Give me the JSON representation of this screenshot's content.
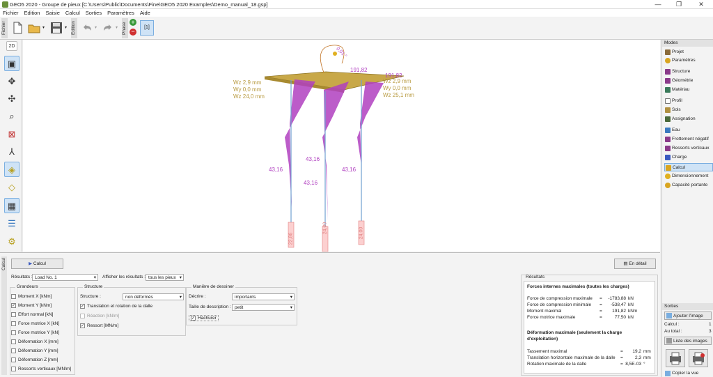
{
  "window": {
    "title": "GEO5 2020 - Groupe de pieux [C:\\Users\\Public\\Documents\\Fine\\GEO5 2020 Examples\\Demo_manual_18.gsp]",
    "minimize": "—",
    "maximize": "❐",
    "close": "✕"
  },
  "menu": [
    "Fichier",
    "Edition",
    "Saisie",
    "Calcul",
    "Sorties",
    "Paramètres",
    "Aide"
  ],
  "toolbar": {
    "fichier_tab": "Fichier",
    "edition_tab": "Edition",
    "phase_tab": "Phase",
    "phase_value": "[1]"
  },
  "view": {
    "mode_2d": "2D"
  },
  "drawing": {
    "labels_left": [
      "Wz 2,9 mm",
      "Wy 0,0 mm",
      "Wz 24,0 mm"
    ],
    "labels_right": [
      "Wz 2,9 mm",
      "Wy 0,0 mm",
      "Wz 25,1 mm"
    ],
    "moment_top": "191,82",
    "moment_top2": "191,82",
    "moment_mid1": "43,16",
    "moment_mid2": "43,16",
    "moment_mid3": "43,16",
    "moment_mid4": "43,16",
    "rotation": "0,01 °",
    "pile_base_left": "22,86",
    "pile_base_mid": "24,00",
    "pile_base_right": "24,00"
  },
  "modes": {
    "header": "Modes",
    "items": [
      {
        "label": "Projet",
        "color": "#8a6a3a"
      },
      {
        "label": "Paramètres",
        "color": "#d9a520"
      },
      {
        "label": "Structure",
        "color": "#8a3a8a"
      },
      {
        "label": "Géométrie",
        "color": "#8a3a8a"
      },
      {
        "label": "Matériau",
        "color": "#3a7a5a"
      },
      {
        "label": "Profil",
        "color": "#777"
      },
      {
        "label": "Sols",
        "color": "#b09040"
      },
      {
        "label": "Assignation",
        "color": "#4a6a3a"
      },
      {
        "label": "Eau",
        "color": "#3a7ac0"
      },
      {
        "label": "Frottement négatif",
        "color": "#8a3a8a"
      },
      {
        "label": "Ressorts verticaux",
        "color": "#8a3a8a"
      },
      {
        "label": "Charge",
        "color": "#3a5ac0"
      },
      {
        "label": "Calcul",
        "color": "#d9a520"
      },
      {
        "label": "Dimensionnement",
        "color": "#e0b020"
      },
      {
        "label": "Capacité portante",
        "color": "#d9a520"
      }
    ]
  },
  "sorties": {
    "header": "Sorties",
    "add_image": "Ajouter l'image",
    "calc_label": "Calcul :",
    "calc_value": "1",
    "total_label": "Au total :",
    "total_value": "3",
    "image_list": "Liste des images",
    "copy_view": "Copier la vue"
  },
  "bottom": {
    "calc_button": "Calcul",
    "detail_button": "En détail",
    "results_label": "Résultats :",
    "results_value": "Load No. 1",
    "show_label": "Afficher les résultats :",
    "show_value": "tous les pieux",
    "grandeurs_title": "Grandeurs",
    "grandeurs": [
      {
        "label": "Moment X [kNm]",
        "checked": false
      },
      {
        "label": "Moment Y [kNm]",
        "checked": true
      },
      {
        "label": "Effort normal [kN]",
        "checked": false
      },
      {
        "label": "Force motrice X [kN]",
        "checked": false
      },
      {
        "label": "Force motrice Y [kN]",
        "checked": false
      },
      {
        "label": "Déformation X [mm]",
        "checked": false
      },
      {
        "label": "Déformation Y [mm]",
        "checked": false
      },
      {
        "label": "Déformation Z [mm]",
        "checked": false
      },
      {
        "label": "Ressorts verticaux [MN/m]",
        "checked": false
      }
    ],
    "structure_title": "Structure",
    "structure_label": "Structure :",
    "structure_value": "non déformés",
    "structure_checks": [
      {
        "label": "Translation et rotation de la dalle",
        "checked": true
      },
      {
        "label": "Réaction [kN/m]",
        "checked": false
      },
      {
        "label": "Ressort [MN/m]",
        "checked": true
      }
    ],
    "dessin_title": "Manière de dessiner",
    "decrire_label": "Décrire :",
    "decrire_value": "importants",
    "taille_label": "Taille de description :",
    "taille_value": "petit",
    "hachurer": "Hachurer",
    "calcul_vtab": "Calcul",
    "resultats_title": "Résultats",
    "forces_title": "Forces internes maximales (toutes les charges)",
    "forces": [
      {
        "name": "Force de compression maximale",
        "eq": "=",
        "value": "-1783,88",
        "unit": "kN"
      },
      {
        "name": "Force de compression minimale",
        "eq": "=",
        "value": "-538,47",
        "unit": "kN"
      },
      {
        "name": "Moment maximal",
        "eq": "=",
        "value": "191,82",
        "unit": "kNm"
      },
      {
        "name": "Force motrice maximale",
        "eq": "=",
        "value": "77,50",
        "unit": "kN"
      }
    ],
    "deform_title": "Déformation maximale (seulement la charge d'exploitation)",
    "deform": [
      {
        "name": "Tassement maximal",
        "eq": "=",
        "value": "19,2",
        "unit": "mm"
      },
      {
        "name": "Translation horizontale maximale de la dalle",
        "eq": "=",
        "value": "2,3",
        "unit": "mm"
      },
      {
        "name": "Rotation maximale de la dalle",
        "eq": "=",
        "value": "8,5E-03",
        "unit": "°"
      }
    ]
  }
}
